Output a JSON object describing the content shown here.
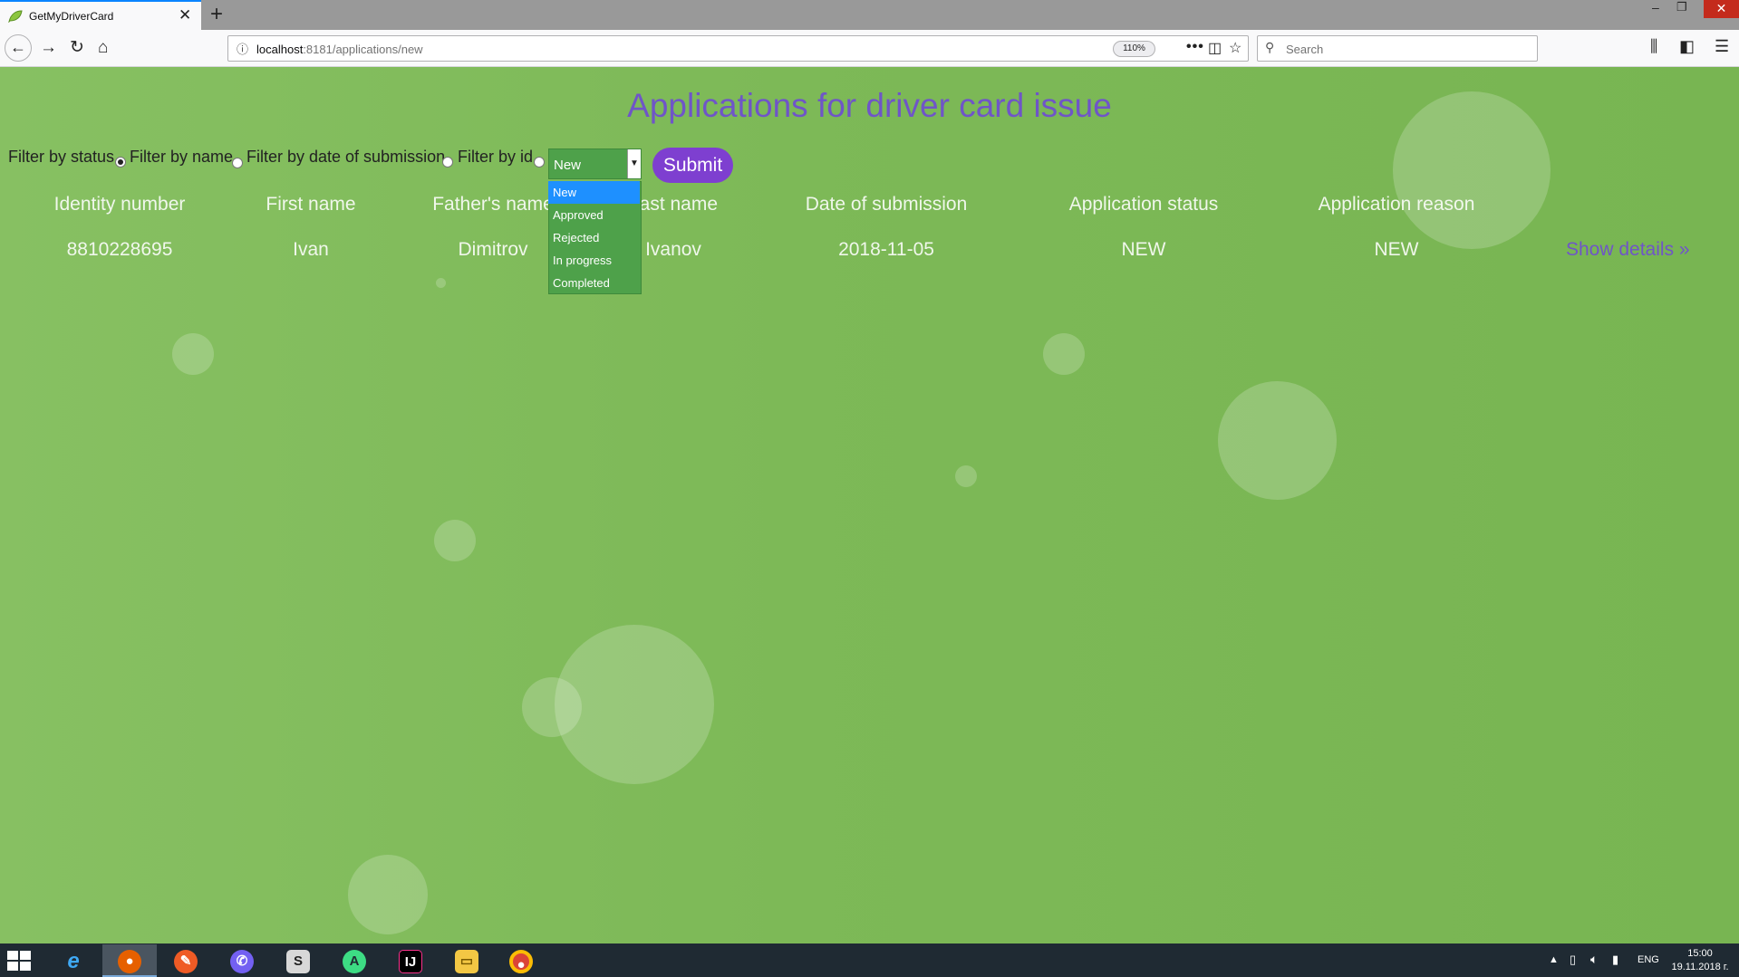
{
  "browser": {
    "tab_title": "GetMyDriverCard",
    "tab_close": "✕",
    "new_tab": "+",
    "window_controls": {
      "minimize": "–",
      "restore": "❐",
      "close": "✕"
    },
    "url_host": "localhost",
    "url_rest": ":8181/applications/new",
    "zoom": "110%",
    "search_placeholder": "Search",
    "icons": [
      "back-icon",
      "forward-icon",
      "reload-icon",
      "home-icon",
      "info-icon",
      "page-actions-icon",
      "pocket-icon",
      "bookmark-star-icon",
      "search-icon",
      "library-icon",
      "sidebar-icon",
      "menu-icon"
    ]
  },
  "page": {
    "title": "Applications for driver card issue",
    "filters": [
      {
        "label": "Filter by status",
        "checked": true
      },
      {
        "label": "Filter by name",
        "checked": false
      },
      {
        "label": "Filter by date of submission",
        "checked": false
      },
      {
        "label": "Filter by id",
        "checked": false
      }
    ],
    "status_select": {
      "value": "New",
      "options": [
        "New",
        "Approved",
        "Rejected",
        "In progress",
        "Completed"
      ]
    },
    "submit_label": "Submit",
    "table": {
      "headers": [
        "Identity number",
        "First name",
        "Father's name",
        "Last name",
        "Date of submission",
        "Application status",
        "Application reason"
      ],
      "rows": [
        {
          "cells": [
            "8810228695",
            "Ivan",
            "Dimitrov",
            "Ivanov",
            "2018-11-05",
            "NEW",
            "NEW"
          ],
          "link": "Show details »"
        }
      ]
    },
    "colors": {
      "background": "#7fba5a",
      "accent": "#6f55c8",
      "submit": "#7e3fd0",
      "select": "#4ea14a"
    }
  },
  "taskbar": {
    "apps": [
      "windows-start-icon",
      "internet-explorer-icon",
      "firefox-icon",
      "postman-icon",
      "viber-icon",
      "sublime-icon",
      "android-studio-icon",
      "intellij-icon",
      "file-explorer-icon",
      "chrome-icon"
    ],
    "language": "ENG",
    "time": "15:00",
    "date": "19.11.2018 г."
  }
}
